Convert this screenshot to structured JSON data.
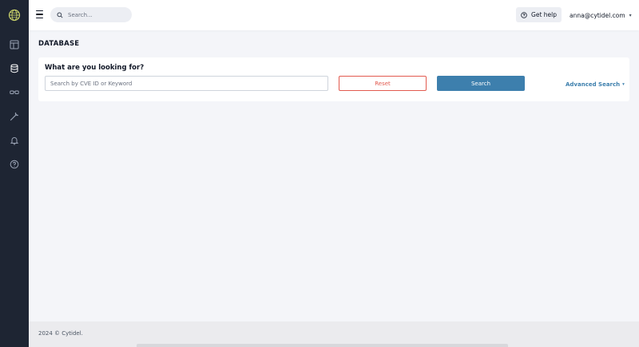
{
  "colors": {
    "sidebar_bg": "#1e2533",
    "accent_blue": "#3d7fad",
    "reset_red": "#e25a4f",
    "page_bg": "#f4f5f9"
  },
  "sidebar": {
    "logo_icon": "globe-logo-icon",
    "items": [
      {
        "icon": "layout-icon",
        "active": false
      },
      {
        "icon": "database-icon",
        "active": true
      },
      {
        "icon": "glasses-icon",
        "active": false
      },
      {
        "icon": "wrench-icon",
        "active": false
      },
      {
        "icon": "bell-icon",
        "active": false
      },
      {
        "icon": "help-circle-icon",
        "active": false
      }
    ]
  },
  "topbar": {
    "search_placeholder": "Search...",
    "help_label": "Get help",
    "user_email": "anna@cytidel.com"
  },
  "main": {
    "page_title": "DATABASE",
    "card": {
      "label": "What are you looking for?",
      "input_placeholder": "Search by CVE ID or Keyword",
      "reset_label": "Reset",
      "search_label": "Search",
      "advanced_label": "Advanced Search"
    }
  },
  "footer": {
    "text": "2024 © Cytidel."
  }
}
